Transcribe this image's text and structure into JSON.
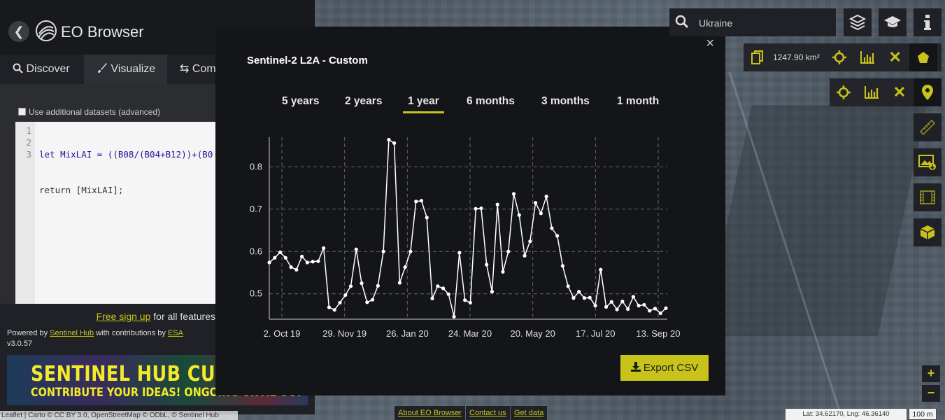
{
  "app": {
    "title": "EO Browser",
    "back_icon": "arrow-left-icon"
  },
  "tabs": [
    {
      "label": "Discover",
      "icon": "search-icon"
    },
    {
      "label": "Visualize",
      "icon": "brush-icon",
      "active": true
    },
    {
      "label": "Com",
      "icon": "compare-arrows-icon"
    }
  ],
  "editor": {
    "checkbox_label": "Use additional datasets (advanced)",
    "line_numbers": [
      "1",
      "2",
      "3"
    ],
    "code_line1": "let MixLAI = ((B08/(B04+B12))+(B0",
    "code_line2": "return [MixLAI];",
    "code_line3": ""
  },
  "footer_left": {
    "signup_link": "Free sign up",
    "signup_rest": " for all features",
    "powered_prefix": "Powered by ",
    "powered_link": "Sentinel Hub",
    "powered_mid": " with contributions by ",
    "powered_esa": "ESA",
    "version": "v3.0.57",
    "banner_line1": "SENTINEL HUB CUSTOM SCRIP",
    "banner_line2": "CONTRIBUTE YOUR IDEAS! ONGOING UNTIL OCT",
    "attribution": "Leaflet | Carto © CC BY 3.0, OpenStreetMap © ODbL, © Sentinel Hub"
  },
  "modal": {
    "title": "Sentinel-2 L2A - Custom",
    "close": "×",
    "periods": [
      "5 years",
      "2 years",
      "1 year",
      "6 months",
      "3 months",
      "1 month"
    ],
    "active_period": "1 year",
    "export_label": "Export CSV"
  },
  "chart_data": {
    "type": "line",
    "title": "",
    "xlabel": "",
    "ylabel": "",
    "x_ticks": [
      "2. Oct 19",
      "29. Nov 19",
      "26. Jan 20",
      "24. Mar 20",
      "20. May 20",
      "17. Jul 20",
      "13. Sep 20"
    ],
    "y_ticks": [
      0.5,
      0.6,
      0.7,
      0.8
    ],
    "ylim": [
      0.44,
      0.87
    ],
    "grid": true,
    "series": [
      {
        "values": [
          0.574,
          0.585,
          0.598,
          0.585,
          0.563,
          0.557,
          0.588,
          0.574,
          0.576,
          0.577,
          0.608,
          0.468,
          0.462,
          0.479,
          0.497,
          0.518,
          0.605,
          0.525,
          0.48,
          0.486,
          0.519,
          0.6,
          0.864,
          0.856,
          0.526,
          0.563,
          0.6,
          0.718,
          0.72,
          0.68,
          0.489,
          0.518,
          0.513,
          0.499,
          0.446,
          0.597,
          0.485,
          0.479,
          0.701,
          0.702,
          0.569,
          0.505,
          0.711,
          0.552,
          0.6,
          0.736,
          0.686,
          0.59,
          0.624,
          0.715,
          0.69,
          0.73,
          0.655,
          0.637,
          0.566,
          0.518,
          0.49,
          0.505,
          0.49,
          0.491,
          0.472,
          0.557,
          0.469,
          0.481,
          0.463,
          0.482,
          0.464,
          0.493,
          0.472,
          0.474,
          0.46,
          0.465,
          0.454,
          0.466
        ]
      }
    ]
  },
  "search": {
    "value": "Ukraine",
    "icon": "search-icon"
  },
  "toolbar": {
    "layers_icon": "layers-icon",
    "education_icon": "graduation-cap-icon",
    "info_icon": "info-icon",
    "area_label": "1247.90 km²",
    "ruler_icon": "ruler-icon",
    "image_download_icon": "image-download-icon",
    "timelapse_icon": "film-icon",
    "3d_icon": "cube-icon",
    "zoom_in": "+",
    "zoom_out": "−"
  },
  "map_footer": {
    "about": "About EO Browser",
    "contact": "Contact us",
    "getdata": "Get data",
    "latlng": "Lat: 34.62170, Lng: 46.36140",
    "scale": "100 m"
  },
  "colors": {
    "accent": "#c8c31a",
    "panel": "#1f2126",
    "modal": "#141519"
  }
}
